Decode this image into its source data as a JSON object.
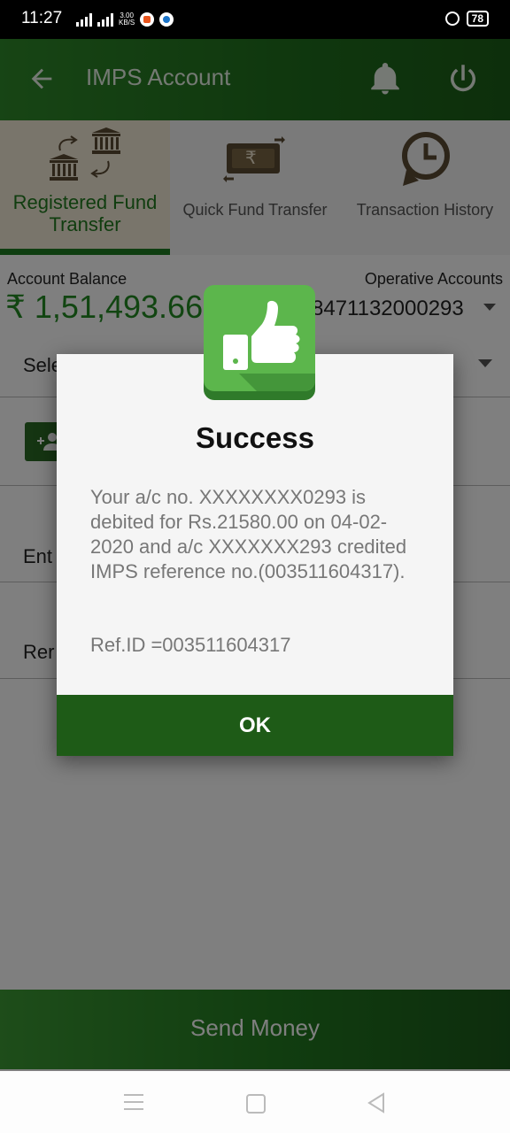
{
  "status_bar": {
    "time": "11:27",
    "net_speed_value": "3.00",
    "net_speed_unit": "KB/S",
    "battery": "78"
  },
  "header": {
    "title": "IMPS Account"
  },
  "tabs": [
    {
      "label": "Registered Fund Transfer",
      "active": true
    },
    {
      "label": "Quick Fund Transfer",
      "active": false
    },
    {
      "label": "Transaction History",
      "active": false
    }
  ],
  "balance": {
    "label": "Account Balance",
    "value": "₹ 1,51,493.66"
  },
  "operative": {
    "label": "Operative Accounts",
    "value": "8471132000293"
  },
  "form": {
    "select_partial": "Sele",
    "enter_partial": "Ent",
    "remark_partial": "Rer"
  },
  "send_money_label": "Send Money",
  "dialog": {
    "title": "Success",
    "message": "Your a/c no. XXXXXXXX0293 is debited for Rs.21580.00 on 04-02-2020 and a/c XXXXXXX293 credited IMPS reference no.(003511604317).",
    "ref": "Ref.ID =003511604317",
    "ok_label": "OK"
  },
  "colors": {
    "brand_green": "#1f6e1c",
    "accent_green": "#228a22",
    "ok_button": "#1e5b17"
  }
}
